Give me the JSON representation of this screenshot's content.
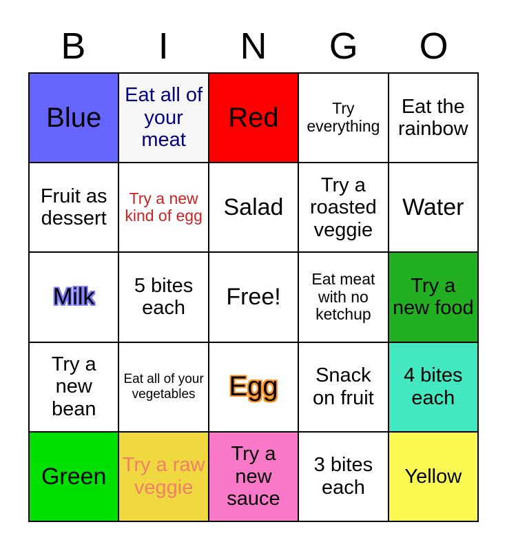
{
  "header": {
    "letters": [
      "B",
      "I",
      "N",
      "G",
      "O"
    ]
  },
  "colors": {
    "periwinkle": "#6666FF",
    "red": "#FE0000",
    "green_medium": "#22B022",
    "green_bright": "#00E000",
    "turquoise": "#44E8C0",
    "gold": "#F0D840",
    "hot_pink": "#FA78C8",
    "yellow": "#FAFA52",
    "white": "#FFFFFF",
    "navy_text": "#000080",
    "red_text": "#CC2222",
    "salmon_text": "#F08068",
    "black_text": "#000000",
    "grid_border": "#000000",
    "blue_outline": "#7A7AFF",
    "orange_outline": "#FF9326"
  },
  "grid": {
    "rows": [
      [
        {
          "text": "Blue",
          "bg": "#6666FF",
          "fg": "#000000",
          "size": "xl",
          "effect": "none"
        },
        {
          "text": "Eat all of your meat",
          "bg": "#F7F7F7",
          "fg": "#000080",
          "size": "md",
          "effect": "none"
        },
        {
          "text": "Red",
          "bg": "#FE0000",
          "fg": "#000000",
          "size": "xl",
          "effect": "none"
        },
        {
          "text": "Try everything",
          "bg": "#FFFFFF",
          "fg": "#000000",
          "size": "sm",
          "effect": "none"
        },
        {
          "text": "Eat the rainbow",
          "bg": "#FFFFFF",
          "fg": "#000000",
          "size": "md",
          "effect": "none"
        }
      ],
      [
        {
          "text": "Fruit as dessert",
          "bg": "#FFFFFF",
          "fg": "#000000",
          "size": "md",
          "effect": "none"
        },
        {
          "text": "Try a new kind of egg",
          "bg": "#FFFFFF",
          "fg": "#CC2222",
          "size": "sm",
          "effect": "none"
        },
        {
          "text": "Salad",
          "bg": "#FFFFFF",
          "fg": "#000000",
          "size": "lg",
          "effect": "none"
        },
        {
          "text": "Try a roasted veggie",
          "bg": "#FFFFFF",
          "fg": "#000000",
          "size": "md",
          "effect": "none"
        },
        {
          "text": "Water",
          "bg": "#FFFFFF",
          "fg": "#000000",
          "size": "lg",
          "effect": "none"
        }
      ],
      [
        {
          "text": "Milk",
          "bg": "#FFFFFF",
          "fg": "#000000",
          "size": "lg",
          "effect": "blue-outline"
        },
        {
          "text": "5 bites each",
          "bg": "#FFFFFF",
          "fg": "#000000",
          "size": "md",
          "effect": "none"
        },
        {
          "text": "Free!",
          "bg": "#FFFFFF",
          "fg": "#000000",
          "size": "lg",
          "effect": "none"
        },
        {
          "text": "Eat meat with no ketchup",
          "bg": "#FFFFFF",
          "fg": "#000000",
          "size": "sm",
          "effect": "none"
        },
        {
          "text": "Try a new food",
          "bg": "#22B022",
          "fg": "#000000",
          "size": "md",
          "effect": "none"
        }
      ],
      [
        {
          "text": "Try a new bean",
          "bg": "#FFFFFF",
          "fg": "#000000",
          "size": "md",
          "effect": "none"
        },
        {
          "text": "Eat all of your vegetables",
          "bg": "#FFFFFF",
          "fg": "#000000",
          "size": "xs",
          "effect": "none"
        },
        {
          "text": "Egg",
          "bg": "#FFFFFF",
          "fg": "#000000",
          "size": "xl",
          "effect": "orange-outline"
        },
        {
          "text": "Snack on fruit",
          "bg": "#FFFFFF",
          "fg": "#000000",
          "size": "md",
          "effect": "none"
        },
        {
          "text": "4 bites each",
          "bg": "#44E8C0",
          "fg": "#000000",
          "size": "md",
          "effect": "none"
        }
      ],
      [
        {
          "text": "Green",
          "bg": "#00E000",
          "fg": "#000000",
          "size": "lg",
          "effect": "none"
        },
        {
          "text": "Try a raw veggie",
          "bg": "#F0D840",
          "fg": "#F08068",
          "size": "md",
          "effect": "none"
        },
        {
          "text": "Try a new sauce",
          "bg": "#FA78C8",
          "fg": "#000000",
          "size": "md",
          "effect": "none"
        },
        {
          "text": "3 bites each",
          "bg": "#FFFFFF",
          "fg": "#000000",
          "size": "md",
          "effect": "none"
        },
        {
          "text": "Yellow",
          "bg": "#FAFA52",
          "fg": "#000000",
          "size": "md",
          "effect": "none"
        }
      ]
    ]
  }
}
